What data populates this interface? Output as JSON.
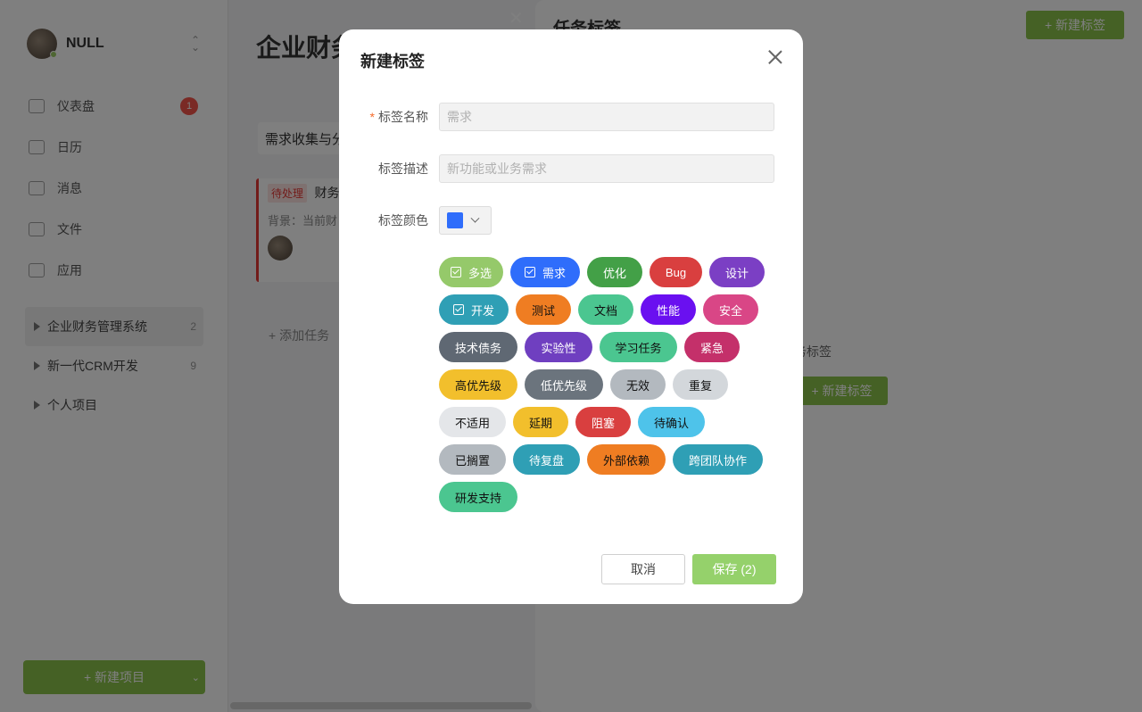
{
  "app": {
    "user": {
      "name": "NULL"
    },
    "nav": [
      {
        "label": "仪表盘",
        "badge": "1",
        "icon": "dashboard-icon"
      },
      {
        "label": "日历",
        "icon": "calendar-icon"
      },
      {
        "label": "消息",
        "icon": "message-icon"
      },
      {
        "label": "文件",
        "icon": "file-icon"
      },
      {
        "label": "应用",
        "icon": "apps-icon"
      }
    ],
    "projects": [
      {
        "name": "企业财务管理系统",
        "count": "2"
      },
      {
        "name": "新一代CRM开发",
        "count": "9"
      },
      {
        "name": "个人项目",
        "count": ""
      }
    ],
    "new_project_label": "+ 新建项目"
  },
  "main": {
    "title": "企业财务",
    "column_title": "需求收集与分",
    "task": {
      "status": "待处理",
      "title": "财务报",
      "desc": "背景：当前财"
    },
    "add_task": "+ 添加任务"
  },
  "panel": {
    "title": "任务标签",
    "new_label": "+ 新建标签",
    "empty_text": "项目暂无任务标签",
    "empty_button": "+ 新建标签"
  },
  "dialog": {
    "title": "新建标签",
    "name_label": "标签名称",
    "name_placeholder": "需求",
    "desc_label": "标签描述",
    "desc_placeholder": "新功能或业务需求",
    "color_label": "标签颜色",
    "selected_color": "#2f6dfb",
    "cancel": "取消",
    "save": "保存 (2)",
    "chip_rows": [
      [
        {
          "text": "多选",
          "bg": "#95c96a",
          "fg": "#ffffff",
          "checked": true,
          "w": 72
        },
        {
          "text": "需求",
          "bg": "#2f6dfb",
          "fg": "#ffffff",
          "checked": true,
          "w": 78
        },
        {
          "text": "优化",
          "bg": "#43a047",
          "fg": "#ffffff",
          "checked": false,
          "w": 62
        },
        {
          "text": "Bug",
          "bg": "#d93f3f",
          "fg": "#ffffff",
          "checked": false,
          "w": 59
        },
        {
          "text": "设计",
          "bg": "#7b3fc4",
          "fg": "#ffffff",
          "checked": false,
          "w": 62
        }
      ],
      [
        {
          "text": "开发",
          "bg": "#2f9fb5",
          "fg": "#ffffff",
          "checked": true,
          "w": 78
        },
        {
          "text": "测试",
          "bg": "#ef7d22",
          "fg": "#111111",
          "checked": false,
          "w": 62
        },
        {
          "text": "文档",
          "bg": "#4bc690",
          "fg": "#111111",
          "checked": false,
          "w": 62
        },
        {
          "text": "性能",
          "bg": "#6a10f0",
          "fg": "#ffffff",
          "checked": false,
          "w": 62
        },
        {
          "text": "安全",
          "bg": "#d94686",
          "fg": "#ffffff",
          "checked": false,
          "w": 62
        }
      ],
      [
        {
          "text": "技术债务",
          "bg": "#5f6873",
          "fg": "#ffffff",
          "checked": false,
          "w": 88
        },
        {
          "text": "实验性",
          "bg": "#6f3fc0",
          "fg": "#ffffff",
          "checked": false,
          "w": 76
        },
        {
          "text": "学习任务",
          "bg": "#4bc690",
          "fg": "#111111",
          "checked": false,
          "w": 87
        },
        {
          "text": "紧急",
          "bg": "#c4306a",
          "fg": "#ffffff",
          "checked": false,
          "w": 62
        }
      ],
      [
        {
          "text": "高优先级",
          "bg": "#f2bf2c",
          "fg": "#111111",
          "checked": false,
          "w": 88
        },
        {
          "text": "低优先级",
          "bg": "#6b747d",
          "fg": "#ffffff",
          "checked": false,
          "w": 88
        },
        {
          "text": "无效",
          "bg": "#b3b9bf",
          "fg": "#111111",
          "checked": false,
          "w": 62
        },
        {
          "text": "重复",
          "bg": "#d3d7db",
          "fg": "#111111",
          "checked": false,
          "w": 62
        }
      ],
      [
        {
          "text": "不适用",
          "bg": "#e4e6e9",
          "fg": "#111111",
          "checked": false,
          "w": 75
        },
        {
          "text": "延期",
          "bg": "#f2bf2c",
          "fg": "#111111",
          "checked": false,
          "w": 62
        },
        {
          "text": "阻塞",
          "bg": "#d93f3f",
          "fg": "#ffffff",
          "checked": false,
          "w": 62
        },
        {
          "text": "待确认",
          "bg": "#4ec3ea",
          "fg": "#111111",
          "checked": false,
          "w": 75
        }
      ],
      [
        {
          "text": "已搁置",
          "bg": "#b3b9bf",
          "fg": "#111111",
          "checked": false,
          "w": 75
        },
        {
          "text": "待复盘",
          "bg": "#2f9fb5",
          "fg": "#ffffff",
          "checked": false,
          "w": 75
        },
        {
          "text": "外部依赖",
          "bg": "#ef7d22",
          "fg": "#111111",
          "checked": false,
          "w": 88
        },
        {
          "text": "跨团队协作",
          "bg": "#2f9fb5",
          "fg": "#ffffff",
          "checked": false,
          "w": 101
        }
      ],
      [
        {
          "text": "研发支持",
          "bg": "#4bc690",
          "fg": "#111111",
          "checked": false,
          "w": 88
        }
      ]
    ]
  }
}
